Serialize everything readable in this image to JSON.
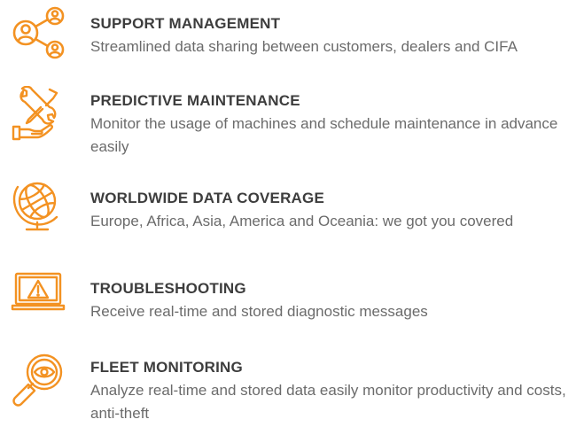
{
  "accent_color": "#f39222",
  "features": [
    {
      "icon": "people-network-icon",
      "title": "SUPPORT MANAGEMENT",
      "description": "Streamlined data sharing between customers, dealers and CIFA"
    },
    {
      "icon": "wrench-screwdriver-hand-icon",
      "title": "PREDICTIVE MAINTENANCE",
      "description": "Monitor the usage of machines and schedule maintenance in advance easily"
    },
    {
      "icon": "globe-icon",
      "title": "WORLDWIDE DATA COVERAGE",
      "description": "Europe, Africa, Asia, America and Oceania: we got you covered"
    },
    {
      "icon": "laptop-warning-icon",
      "title": "TROUBLESHOOTING",
      "description": "Receive real-time and stored diagnostic messages"
    },
    {
      "icon": "magnifier-eye-icon",
      "title": "FLEET MONITORING",
      "description": "Analyze real-time and stored data easily monitor productivity and costs, anti-theft"
    }
  ]
}
